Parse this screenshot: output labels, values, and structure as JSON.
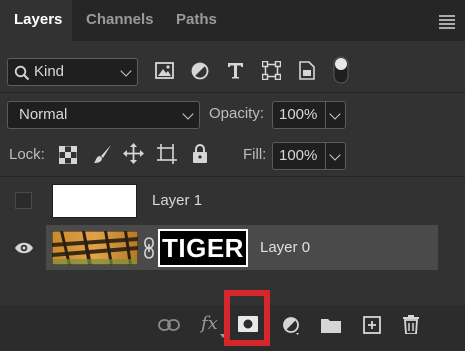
{
  "tabs": [
    {
      "label": "Layers",
      "active": true
    },
    {
      "label": "Channels",
      "active": false
    },
    {
      "label": "Paths",
      "active": false
    }
  ],
  "filter": {
    "kind_label": "Kind",
    "icons": [
      "image-filter-icon",
      "adjustment-filter-icon",
      "type-filter-icon",
      "shape-filter-icon",
      "smart-object-filter-icon",
      "filter-toggle-icon"
    ]
  },
  "blend": {
    "mode": "Normal",
    "opacity_label": "Opacity:",
    "opacity_value": "100%"
  },
  "lock": {
    "label": "Lock:",
    "icons": [
      "lock-transparent-pixels-icon",
      "lock-image-pixels-icon",
      "lock-position-icon",
      "lock-artboard-icon",
      "lock-all-icon"
    ],
    "fill_label": "Fill:",
    "fill_value": "100%"
  },
  "layers": [
    {
      "name": "Layer 1",
      "visible": false,
      "selected": false
    },
    {
      "name": "Layer 0",
      "visible": true,
      "selected": true,
      "mask_text": "TIGER"
    }
  ],
  "bottom_toolbar": {
    "icons": [
      "link-layers-icon",
      "layer-style-icon",
      "add-mask-icon",
      "adjustment-layer-icon",
      "new-group-icon",
      "new-layer-icon",
      "delete-layer-icon"
    ],
    "fx_label": "fx",
    "highlight_color": "#d7262b"
  },
  "colors": {
    "panel": "#323232",
    "tabbar": "#262626",
    "selected_row": "#4a4a4a"
  }
}
